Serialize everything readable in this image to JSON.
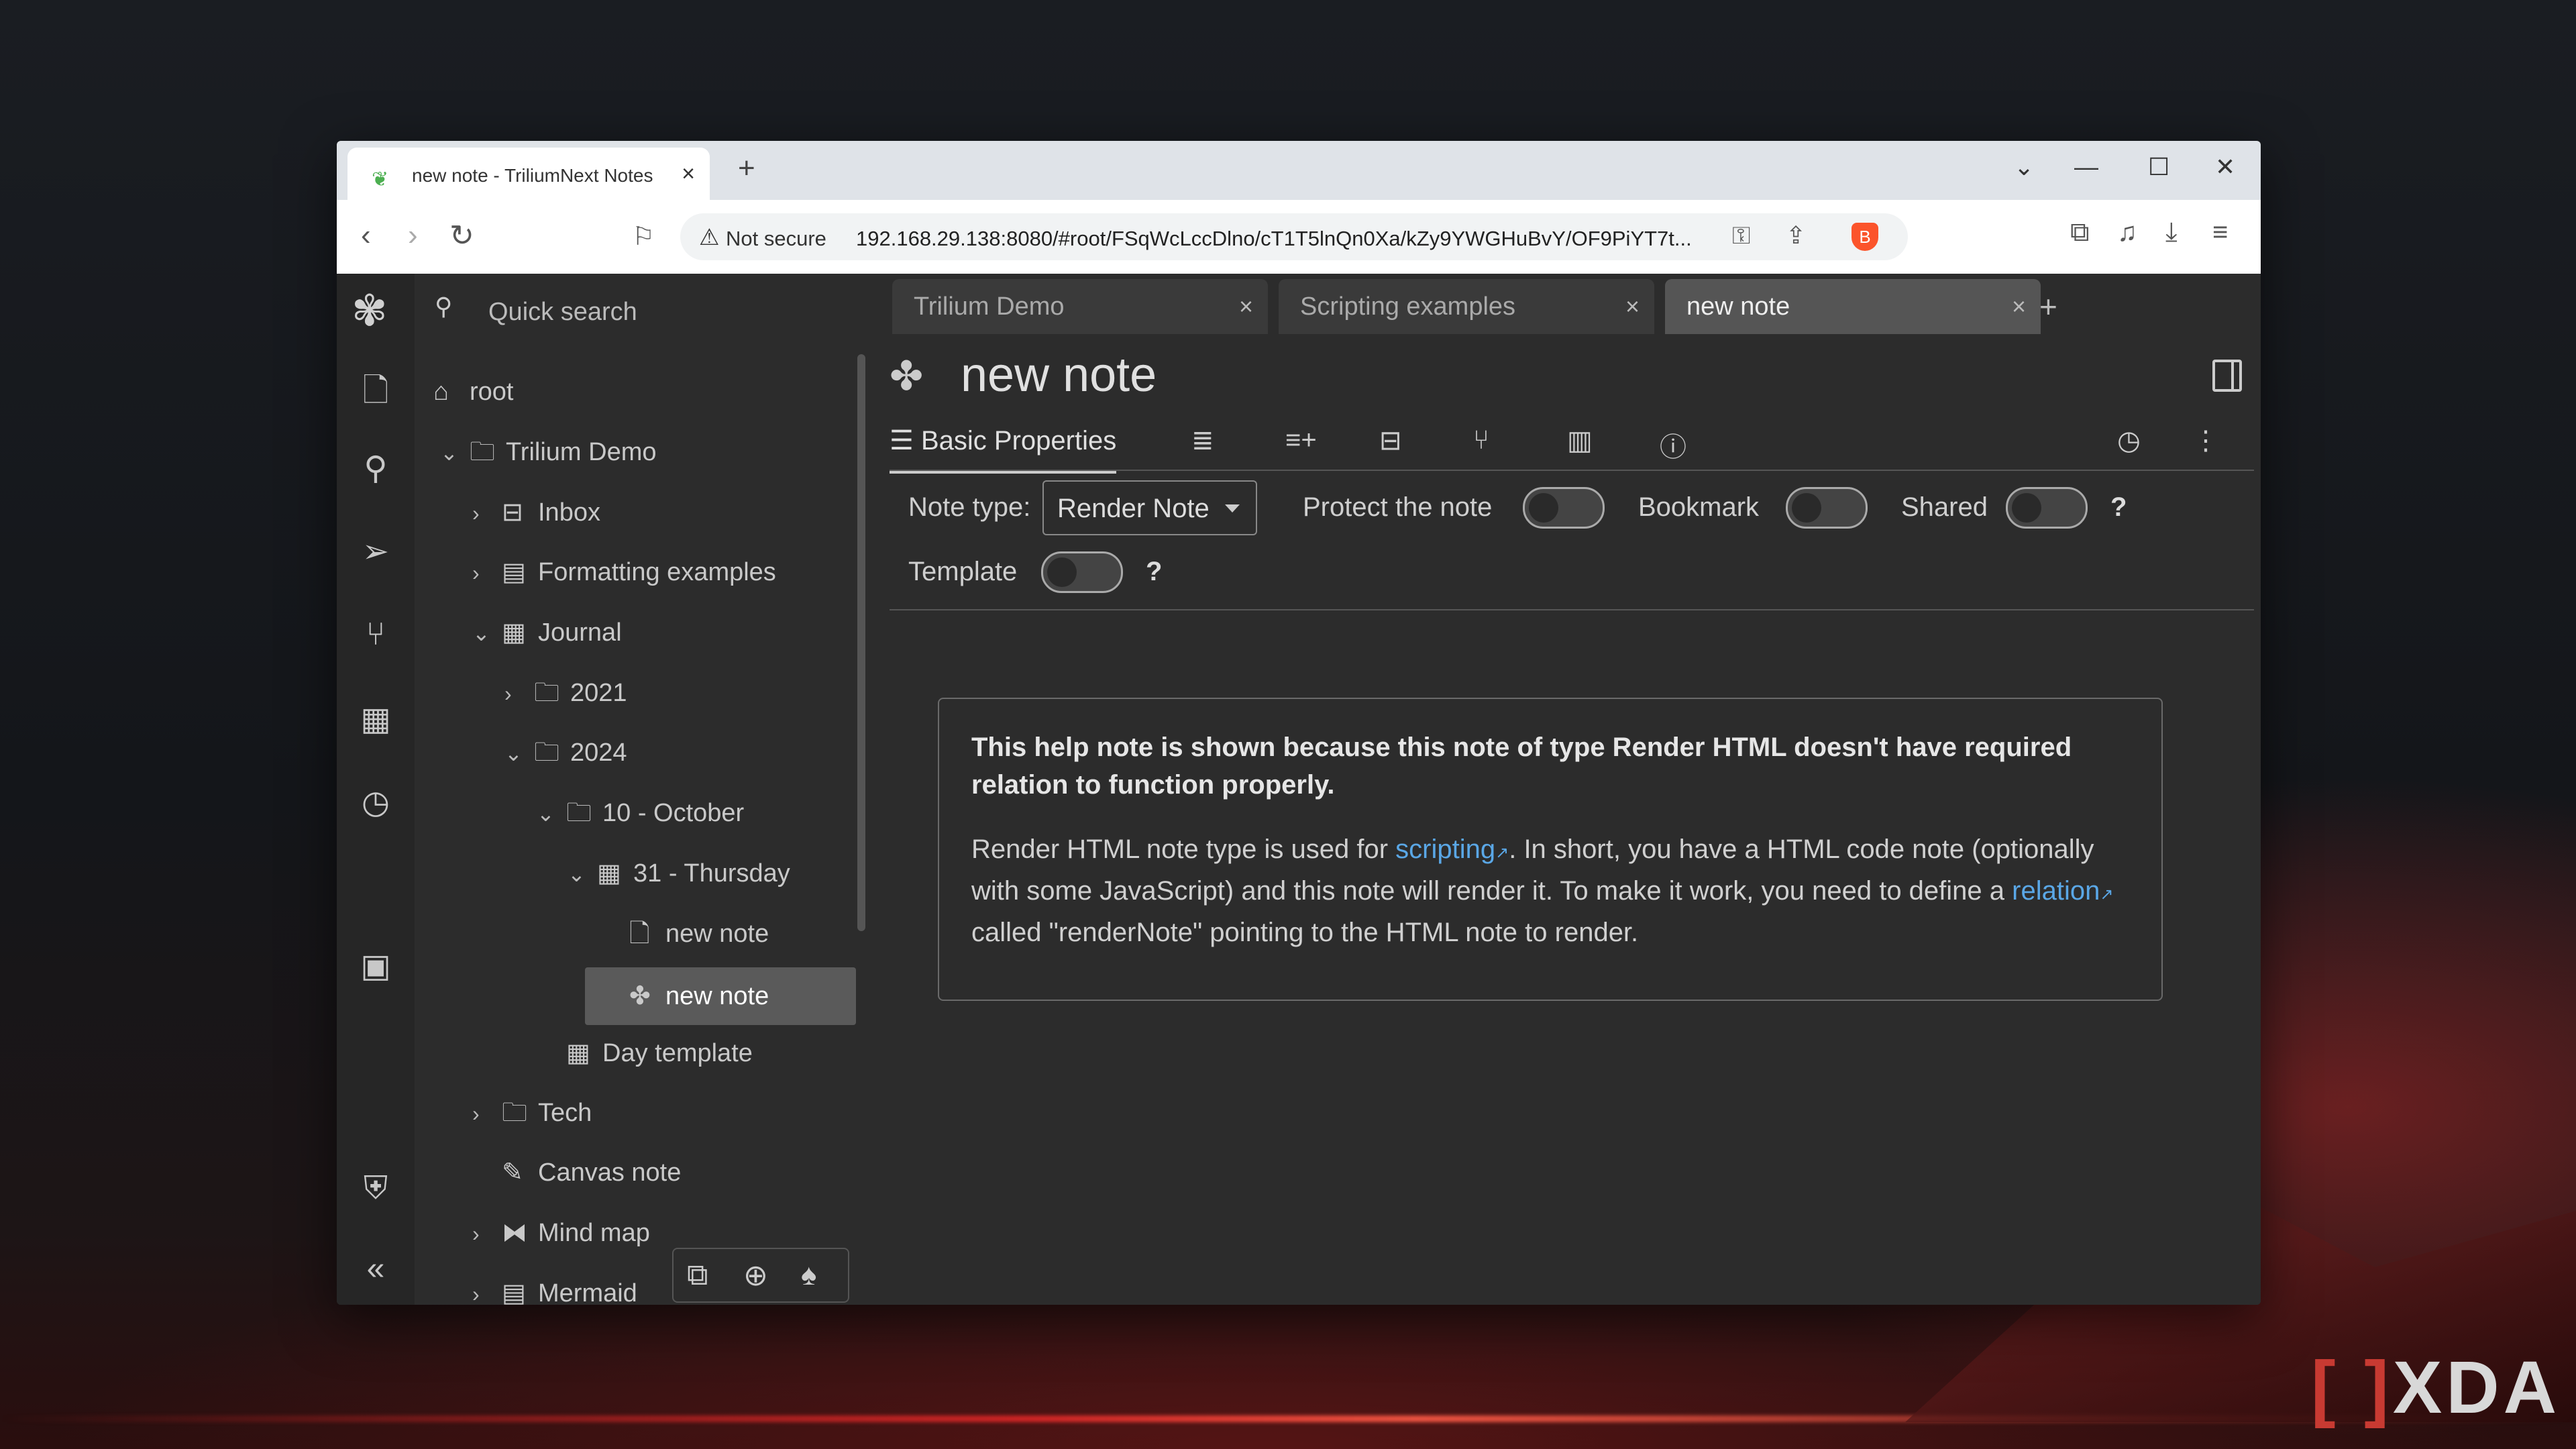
{
  "browser": {
    "tab_title": "new note - TriliumNext Notes",
    "not_secure": "Not secure",
    "url": "192.168.29.138:8080/#root/FSqWcLccDlno/cT1T5lnQn0Xa/kZy9YWGHuBvY/OF9PiYT7t..."
  },
  "sidebar": {
    "quick_search": "Quick search",
    "root": "root",
    "items": [
      {
        "label": "Trilium Demo"
      },
      {
        "label": "Inbox"
      },
      {
        "label": "Formatting examples"
      },
      {
        "label": "Journal"
      },
      {
        "label": "2021"
      },
      {
        "label": "2024"
      },
      {
        "label": "10 - October"
      },
      {
        "label": "31 - Thursday"
      },
      {
        "label": "new note"
      },
      {
        "label": "new note"
      },
      {
        "label": "Day template"
      },
      {
        "label": "Tech"
      },
      {
        "label": "Canvas note"
      },
      {
        "label": "Mind map"
      },
      {
        "label": "Mermaid"
      }
    ]
  },
  "note_tabs": [
    "Trilium Demo",
    "Scripting examples",
    "new note"
  ],
  "note": {
    "title": "new note",
    "ribbon_active": "Basic Properties",
    "note_type_label": "Note type:",
    "note_type_value": "Render Note",
    "protect_label": "Protect the note",
    "bookmark_label": "Bookmark",
    "shared_label": "Shared",
    "template_label": "Template",
    "qmark": "?"
  },
  "help": {
    "bold": "This help note is shown because this note of type Render HTML doesn't have required relation to function properly.",
    "p1": "Render HTML note type is used for ",
    "link1": "scripting",
    "p2": ". In short, you have a HTML code note (optionally with some JavaScript) and this note will render it. To make it work, you need to define a ",
    "link2": "relation",
    "p3": " called \"renderNote\" pointing to the HTML note to render."
  },
  "watermark": "XDA"
}
